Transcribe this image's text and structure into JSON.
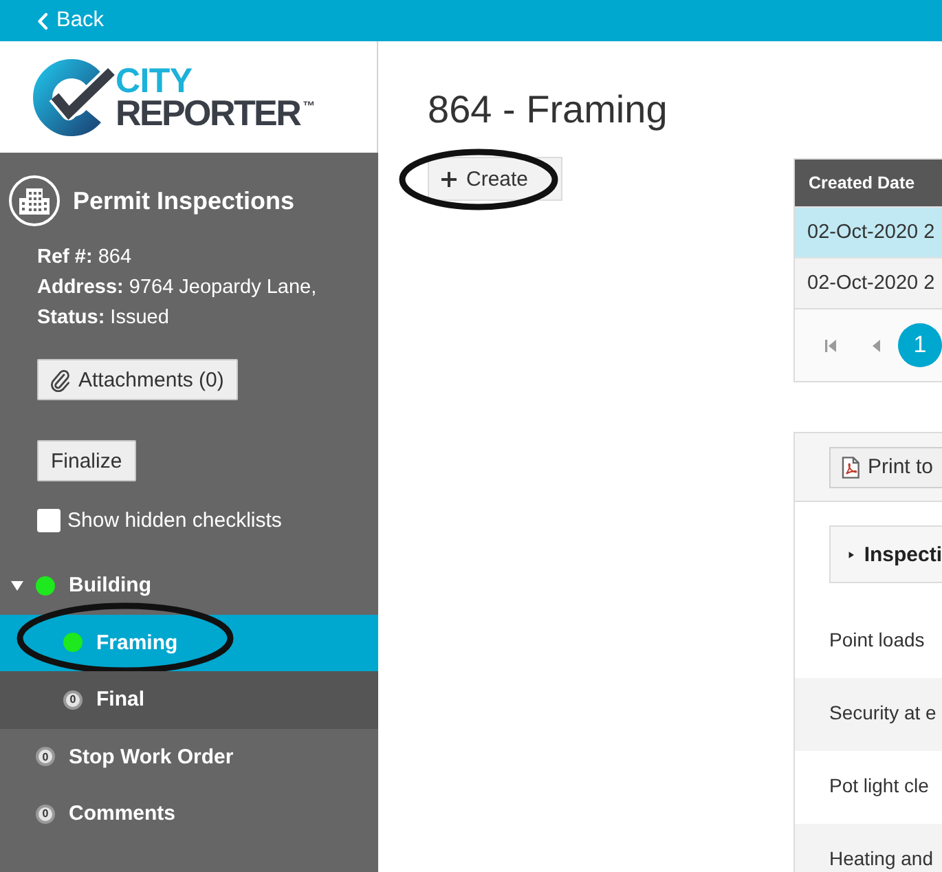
{
  "top_bar": {
    "back_label": "Back"
  },
  "logo": {
    "line_1": "CITY",
    "line_2": "REPORTER",
    "mark": "™"
  },
  "sidebar": {
    "title": "Permit Inspections",
    "details": [
      "**Ref #:** 864",
      "**Address:** 9764 Jeopardy Lane,",
      "**Status:** Issued"
    ],
    "attachments_button": {
      "label": "Attachments (0)"
    },
    "finalize_button": {
      "label": "Finalize"
    },
    "hidden_checklists": {
      "label": "Show hidden checklists",
      "checked": false
    },
    "tree": [
      {
        "label": "Building",
        "kind": "dot",
        "color": "#1ee81e",
        "selected": false,
        "circled": false,
        "expanded": true,
        "children": [
          {
            "label": "Framing",
            "kind": "dot",
            "color": "#1ee81e",
            "selected": true,
            "circled": true
          },
          {
            "label": "Final",
            "kind": "count",
            "badge": "0",
            "selected": false,
            "circled": false
          }
        ]
      },
      {
        "label": "Stop Work Order",
        "kind": "count",
        "badge": "0",
        "selected": false,
        "circled": false
      },
      {
        "label": "Comments",
        "kind": "count",
        "badge": "0",
        "selected": false,
        "circled": false
      }
    ]
  },
  "main": {
    "title": "864 - Framing",
    "create_button": {
      "label": "Create",
      "circled": true
    }
  },
  "table": {
    "columns": [
      "Created Date"
    ],
    "rows": [
      {
        "cells": [
          "02-Oct-2020 2"
        ],
        "selected": true
      },
      {
        "cells": [
          "02-Oct-2020 2"
        ],
        "selected": false
      }
    ],
    "pager": {
      "pages": [
        {
          "label": "1",
          "selected": true
        }
      ]
    }
  },
  "checklist_panel": {
    "print_button": {
      "label": "Print to"
    },
    "section": {
      "title": "Inspecti",
      "expanded": false
    },
    "items": [
      "Point loads",
      "Security at e",
      "Pot light cle",
      "Heating and"
    ]
  }
}
